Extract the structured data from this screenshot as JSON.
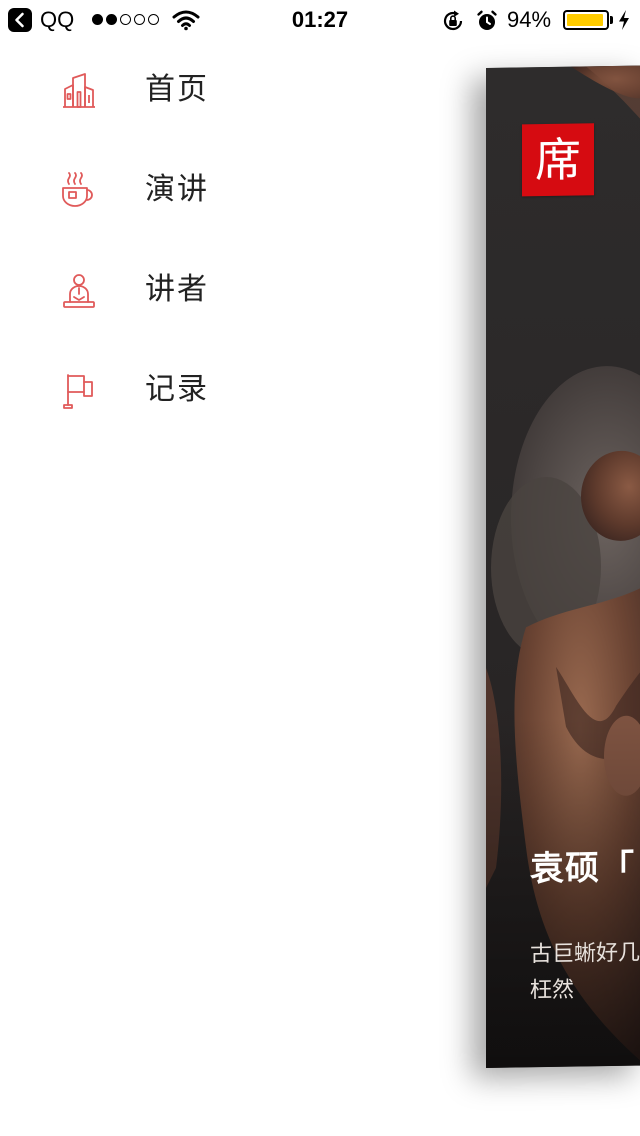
{
  "status_bar": {
    "back_app": "QQ",
    "time": "01:27",
    "battery_percent": "94%",
    "battery_level": 0.94,
    "signal_bars": 2,
    "signal_total": 5,
    "battery_color": "#ffcc00"
  },
  "menu": {
    "accent_color": "#e05a5a",
    "items": [
      {
        "label": "首页",
        "icon": "buildings-icon"
      },
      {
        "label": "演讲",
        "icon": "coffee-cup-icon"
      },
      {
        "label": "讲者",
        "icon": "speaker-person-icon"
      },
      {
        "label": "记录",
        "icon": "flag-icon"
      }
    ]
  },
  "card": {
    "logo_text": "席",
    "logo_color": "#d60b11",
    "title": "袁硕「",
    "description": "古巨蜥好几\n枉然"
  }
}
